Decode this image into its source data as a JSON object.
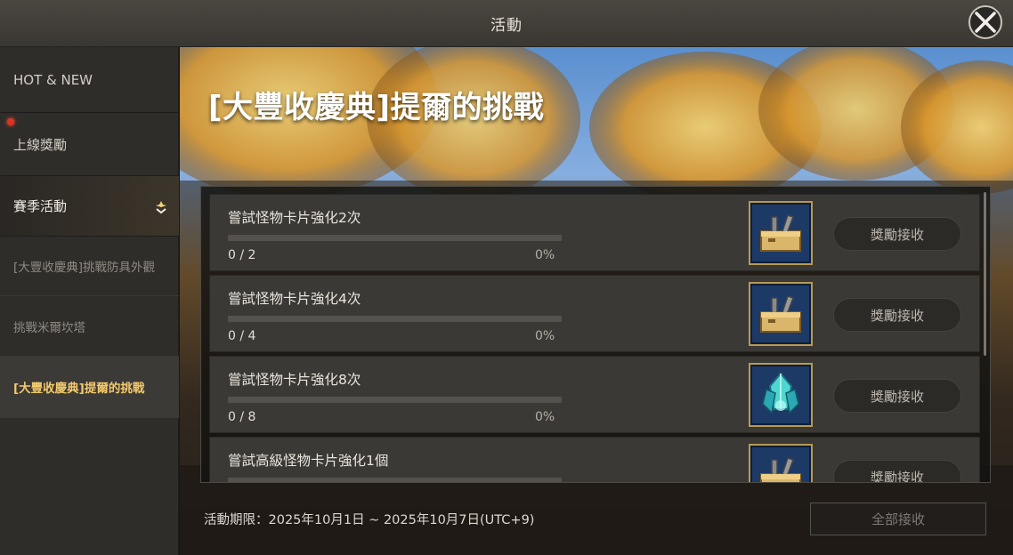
{
  "window": {
    "title": "活動"
  },
  "sidebar": {
    "header": "HOT & NEW",
    "items": [
      {
        "label": "上線獎勵"
      },
      {
        "label": "賽季活動"
      },
      {
        "label": "[大豐收慶典]挑戰防具外觀"
      },
      {
        "label": "挑戰米爾坎塔"
      },
      {
        "label": "[大豐收慶典]提爾的挑戰"
      }
    ]
  },
  "main": {
    "event_title": "[大豐收慶典]提爾的挑戰",
    "missions": [
      {
        "title": "嘗試怪物卡片強化2次",
        "count": "0 / 2",
        "percent": "0%",
        "progress": 0,
        "reward_icon": "toolbox-icon",
        "claim_label": "獎勵接收"
      },
      {
        "title": "嘗試怪物卡片強化4次",
        "count": "0 / 4",
        "percent": "0%",
        "progress": 0,
        "reward_icon": "toolbox-icon",
        "claim_label": "獎勵接收"
      },
      {
        "title": "嘗試怪物卡片強化8次",
        "count": "0 / 8",
        "percent": "0%",
        "progress": 0,
        "reward_icon": "crystal-icon",
        "claim_label": "獎勵接收"
      },
      {
        "title": "嘗試高級怪物卡片強化1個",
        "count": "",
        "percent": "",
        "progress": 0,
        "reward_icon": "toolbox-icon",
        "claim_label": "獎勵接收"
      }
    ],
    "period": "活動期限：2025年10月1日 ~ 2025年10月7日(UTC+9)",
    "claim_all_label": "全部接收"
  },
  "colors": {
    "active_tab_text": "#f1c96e",
    "notification_dot": "#e2321f",
    "icon_bg": "#1d3a66"
  }
}
